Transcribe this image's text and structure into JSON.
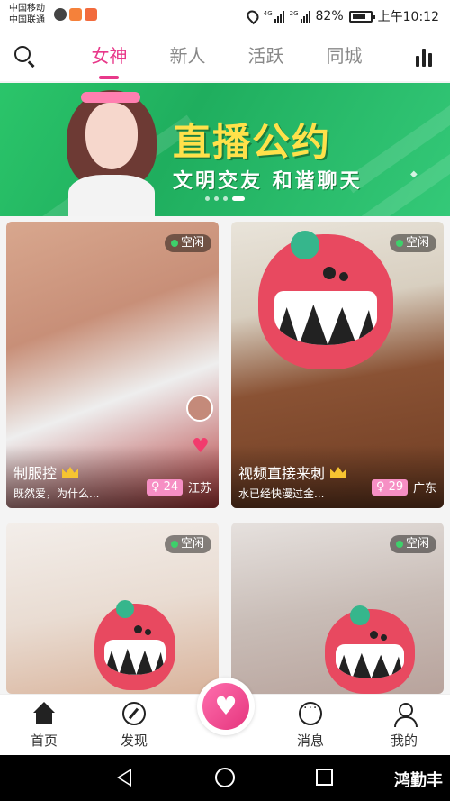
{
  "status_bar": {
    "carrier1": "中国移动",
    "carrier2": "中国联通",
    "net1": "4G",
    "net2": "2G",
    "battery": "82%",
    "time": "上午10:12"
  },
  "header": {
    "tabs": [
      {
        "label": "女神",
        "active": true
      },
      {
        "label": "新人",
        "active": false
      },
      {
        "label": "活跃",
        "active": false
      },
      {
        "label": "同城",
        "active": false
      }
    ]
  },
  "banner": {
    "title": "直播公约",
    "subtitle": "文明交友 和谐聊天",
    "page_count": 4,
    "active_page": 4
  },
  "cards": [
    {
      "status": "空闲",
      "title": "制服控",
      "subtitle": "既然爱，为什么...",
      "age": "♀ 24",
      "location": "江苏"
    },
    {
      "status": "空闲",
      "title": "视频直接来刺",
      "subtitle": "水已经快漫过金...",
      "age": "♀ 29",
      "location": "广东"
    },
    {
      "status": "空闲"
    },
    {
      "status": "空闲"
    }
  ],
  "bottom_nav": {
    "items": [
      {
        "label": "首页",
        "icon": "home-icon"
      },
      {
        "label": "发现",
        "icon": "compass-icon"
      },
      {
        "label": "消息",
        "icon": "message-icon"
      },
      {
        "label": "我的",
        "icon": "profile-icon"
      }
    ]
  },
  "watermark": "鸿勤丰",
  "colors": {
    "accent": "#e8398a",
    "banner": "#2bc56a",
    "online": "#3ed06b"
  }
}
